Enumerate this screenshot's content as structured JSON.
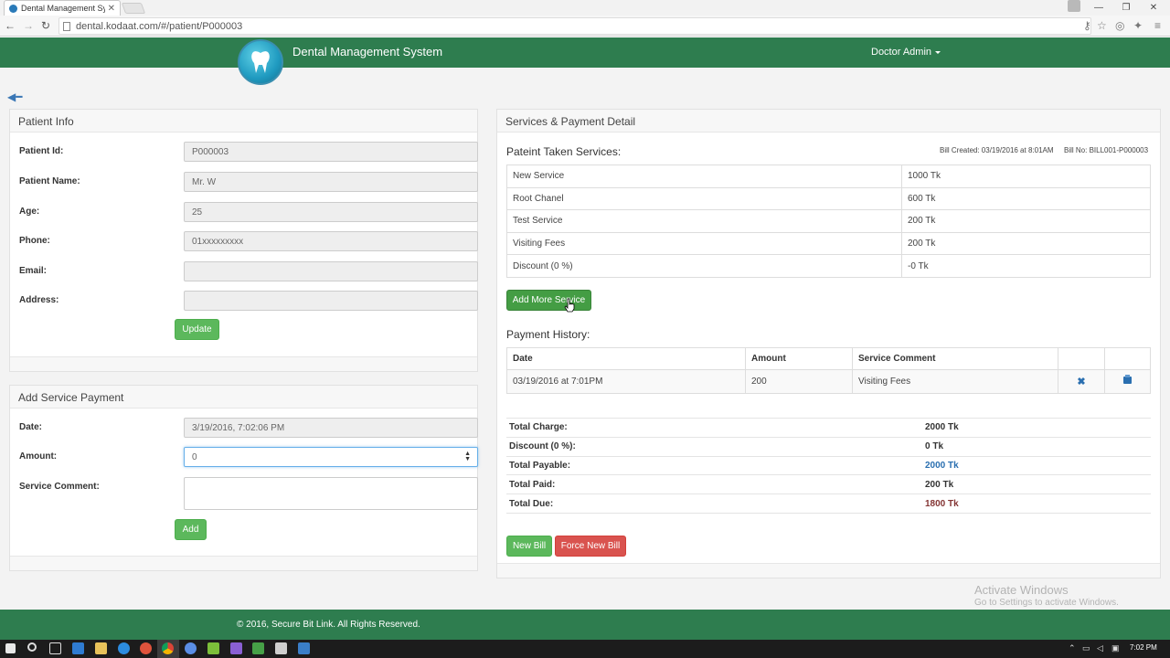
{
  "browser": {
    "tab_title": "Dental Management Syste",
    "url": "dental.kodaat.com/#/patient/P000003"
  },
  "header": {
    "app_title": "Dental Management System",
    "user": "Doctor Admin"
  },
  "patient_info": {
    "title": "Patient Info",
    "fields": [
      {
        "label": "Patient Id:",
        "value": "P000003"
      },
      {
        "label": "Patient Name:",
        "value": "Mr. W"
      },
      {
        "label": "Age:",
        "value": "25"
      },
      {
        "label": "Phone:",
        "value": "01xxxxxxxxx"
      },
      {
        "label": "Email:",
        "value": ""
      },
      {
        "label": "Address:",
        "value": ""
      }
    ],
    "update_label": "Update"
  },
  "add_payment": {
    "title": "Add Service Payment",
    "date_label": "Date:",
    "date_value": "3/19/2016, 7:02:06 PM",
    "amount_label": "Amount:",
    "amount_value": "0",
    "comment_label": "Service Comment:",
    "add_label": "Add"
  },
  "services": {
    "panel_title": "Services & Payment Detail",
    "taken_title": "Pateint Taken Services:",
    "bill_created": "Bill Created: 03/19/2016 at 8:01AM",
    "bill_no": "Bill No: BILL001-P000003",
    "items": [
      {
        "name": "New Service",
        "price": "1000 Tk"
      },
      {
        "name": "Root Chanel",
        "price": "600 Tk"
      },
      {
        "name": "Test Service",
        "price": "200 Tk"
      },
      {
        "name": "Visiting Fees",
        "price": "200 Tk"
      },
      {
        "name": "Discount (0 %)",
        "price": "-0 Tk"
      }
    ],
    "add_more_label": "Add More Service"
  },
  "payment_history": {
    "title": "Payment History:",
    "columns": [
      "Date",
      "Amount",
      "Service Comment"
    ],
    "rows": [
      {
        "date": "03/19/2016 at 7:01PM",
        "amount": "200",
        "comment": "Visiting Fees"
      }
    ]
  },
  "totals": [
    {
      "label": "Total Charge:",
      "value": "2000 Tk"
    },
    {
      "label": "Discount (0 %):",
      "value": "0 Tk"
    },
    {
      "label": "Total Payable:",
      "value": "2000 Tk"
    },
    {
      "label": "Total Paid:",
      "value": "200 Tk"
    },
    {
      "label": "Total Due:",
      "value": "1800 Tk"
    }
  ],
  "bill_actions": {
    "new_bill": "New Bill",
    "force_new_bill": "Force New Bill"
  },
  "footer": {
    "copyright": "© 2016, Secure Bit Link.  All Rights Reserved."
  },
  "watermark": {
    "title": "Activate Windows",
    "subtitle": "Go to Settings to activate Windows."
  },
  "taskbar": {
    "clock": "7:02 PM"
  },
  "colors": {
    "header_green": "#2e7d4f",
    "button_green": "#5cb85c",
    "button_red": "#d9534f",
    "link_blue": "#2a6fb0",
    "due_red": "#843534"
  }
}
